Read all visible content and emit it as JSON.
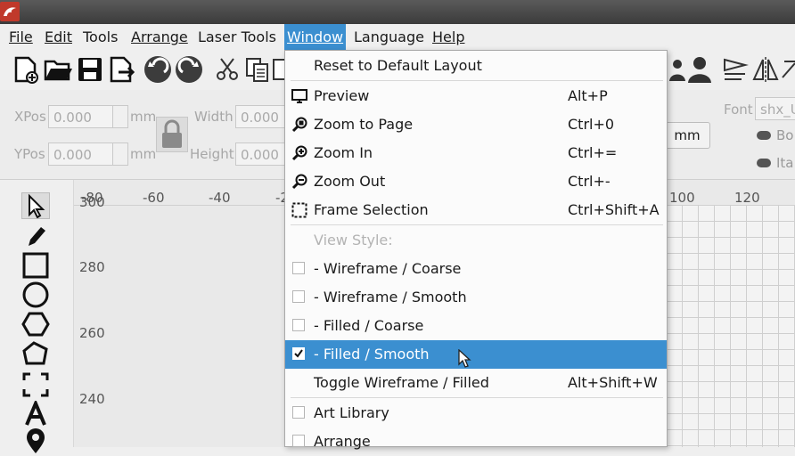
{
  "menubar": {
    "items": [
      {
        "label": "File"
      },
      {
        "label": "Edit"
      },
      {
        "label": "Tools"
      },
      {
        "label": "Arrange"
      },
      {
        "label": "Laser Tools"
      },
      {
        "label": "Window"
      },
      {
        "label": "Language"
      },
      {
        "label": "Help"
      }
    ],
    "active": "Window"
  },
  "properties": {
    "xpos_label": "XPos",
    "xpos_value": "0.000",
    "xpos_unit": "mm",
    "ypos_label": "YPos",
    "ypos_value": "0.000",
    "ypos_unit": "mm",
    "width_label": "Width",
    "width_value": "0.000",
    "height_label": "Height",
    "height_value": "0.000",
    "unit_button": "mm",
    "font_label": "Font",
    "font_value": "shx_U",
    "bold_label": "Bo",
    "italic_label": "Ita"
  },
  "ruler": {
    "top_ticks": [
      "-80",
      "-60",
      "-40",
      "-2",
      "100",
      "120"
    ],
    "left_ticks": [
      "300",
      "280",
      "260",
      "240"
    ]
  },
  "window_menu": {
    "reset": "Reset to Default Layout",
    "preview": {
      "label": "Preview",
      "shortcut": "Alt+P"
    },
    "zoom_page": {
      "label": "Zoom to Page",
      "shortcut": "Ctrl+0"
    },
    "zoom_in": {
      "label": "Zoom In",
      "shortcut": "Ctrl+="
    },
    "zoom_out": {
      "label": "Zoom Out",
      "shortcut": "Ctrl+-"
    },
    "frame_selection": {
      "label": "Frame Selection",
      "shortcut": "Ctrl+Shift+A"
    },
    "view_style_header": "View Style:",
    "wire_coarse": "-  Wireframe / Coarse",
    "wire_smooth": "-  Wireframe / Smooth",
    "filled_coarse": "-  Filled / Coarse",
    "filled_smooth": "-  Filled / Smooth",
    "toggle": {
      "label": "Toggle Wireframe / Filled",
      "shortcut": "Alt+Shift+W"
    },
    "art_library": "Art Library",
    "arrange": "Arrange"
  },
  "colors": {
    "accent": "#3b8fd0",
    "logo": "#c0392b"
  }
}
